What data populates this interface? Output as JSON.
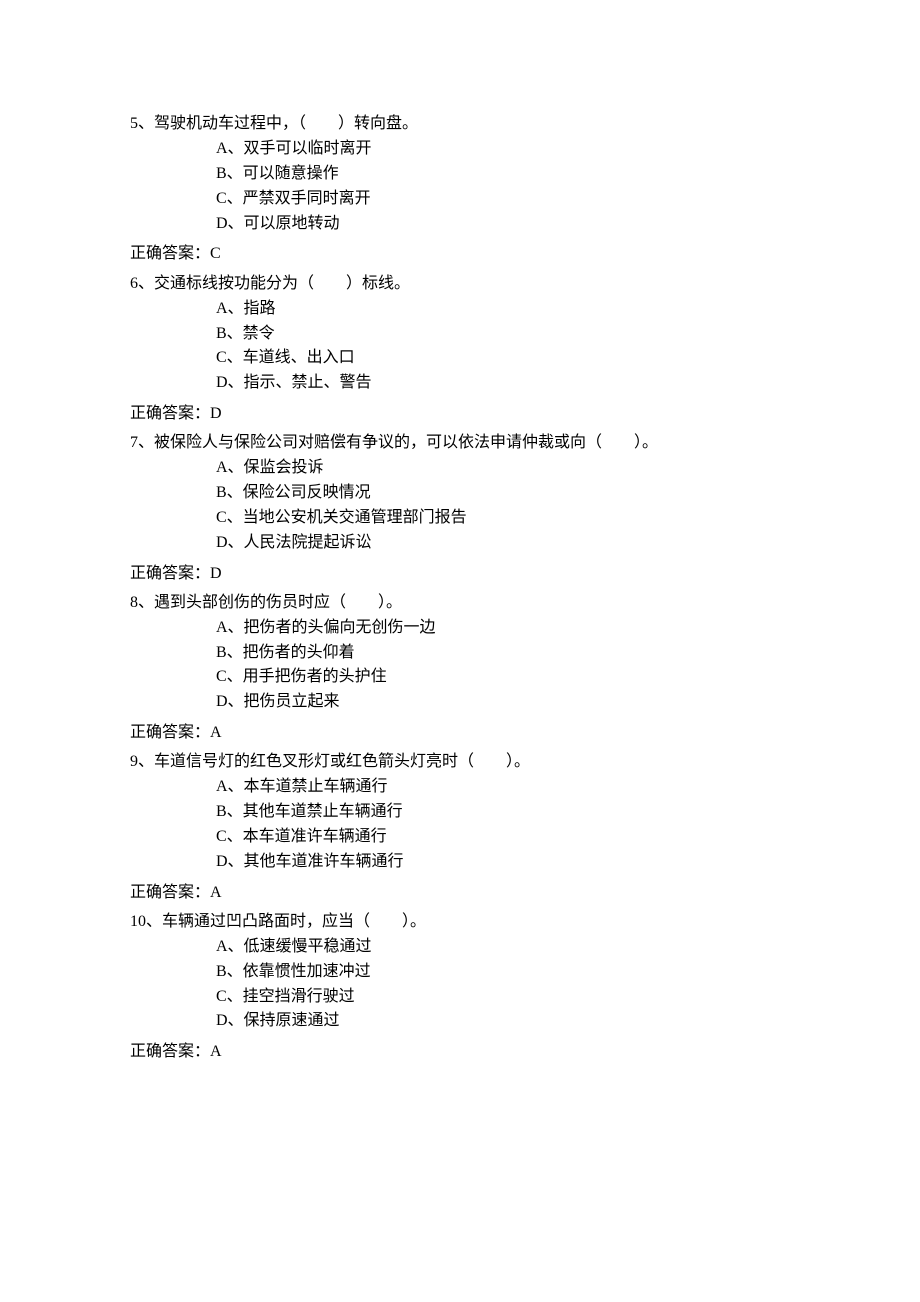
{
  "questions": [
    {
      "number": "5",
      "stem": "、驾驶机动车过程中，（　　）转向盘。",
      "options": [
        "A、双手可以临时离开",
        "B、可以随意操作",
        "C、严禁双手同时离开",
        "D、可以原地转动"
      ],
      "answer_label": "正确答案：",
      "answer": "C"
    },
    {
      "number": "6",
      "stem": "、交通标线按功能分为（　　）标线。",
      "options": [
        "A、指路",
        "B、禁令",
        "C、车道线、出入口",
        "D、指示、禁止、警告"
      ],
      "answer_label": "正确答案：",
      "answer": "D"
    },
    {
      "number": "7",
      "stem": "、被保险人与保险公司对赔偿有争议的，可以依法申请仲裁或向（　　）。",
      "options": [
        "A、保监会投诉",
        "B、保险公司反映情况",
        "C、当地公安机关交通管理部门报告",
        "D、人民法院提起诉讼"
      ],
      "answer_label": "正确答案：",
      "answer": "D"
    },
    {
      "number": "8",
      "stem": "、遇到头部创伤的伤员时应（　　）。",
      "options": [
        "A、把伤者的头偏向无创伤一边",
        "B、把伤者的头仰着",
        "C、用手把伤者的头护住",
        "D、把伤员立起来"
      ],
      "answer_label": "正确答案：",
      "answer": "A"
    },
    {
      "number": "9",
      "stem": "、车道信号灯的红色叉形灯或红色箭头灯亮时（　　）。",
      "options": [
        "A、本车道禁止车辆通行",
        "B、其他车道禁止车辆通行",
        "C、本车道准许车辆通行",
        "D、其他车道准许车辆通行"
      ],
      "answer_label": "正确答案：",
      "answer": "A"
    },
    {
      "number": "10",
      "stem": "、车辆通过凹凸路面时，应当（　　）。",
      "options": [
        "A、低速缓慢平稳通过",
        "B、依靠惯性加速冲过",
        "C、挂空挡滑行驶过",
        "D、保持原速通过"
      ],
      "answer_label": "正确答案：",
      "answer": "A"
    }
  ]
}
